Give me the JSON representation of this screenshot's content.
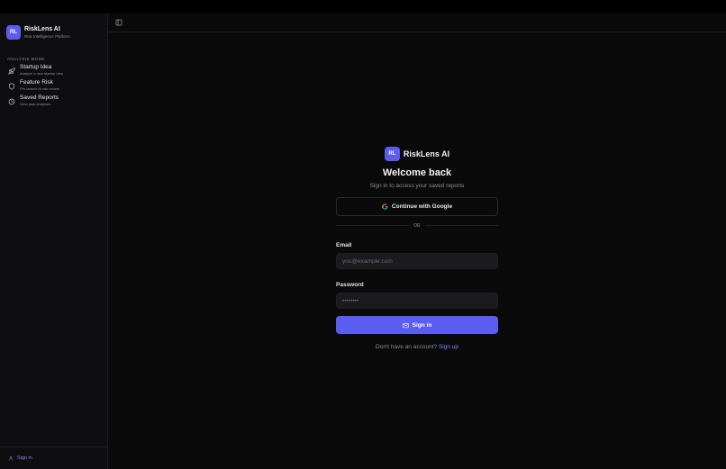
{
  "brand": {
    "initials": "RL",
    "name": "RiskLens AI",
    "subtitle": "Risk Intelligence Platform"
  },
  "sidebar": {
    "section_label": "ANALYSIS MODE",
    "items": [
      {
        "title": "Startup Idea",
        "description": "Analyze a new startup idea",
        "icon": "rocket-icon"
      },
      {
        "title": "Feature Risk",
        "description": "Pre-launch AI risk review",
        "icon": "shield-icon"
      },
      {
        "title": "Saved Reports",
        "description": "View past analyses",
        "icon": "clock-icon"
      }
    ],
    "footer_signin": "Sign in"
  },
  "auth": {
    "brand_initials": "RL",
    "brand_name": "RiskLens AI",
    "title": "Welcome back",
    "subtitle": "Sign in to access your saved reports",
    "google_label": "Continue with Google",
    "divider": "OR",
    "email_label": "Email",
    "email_placeholder": "you@example.com",
    "password_label": "Password",
    "password_placeholder": "••••••••",
    "signin_label": "Sign in",
    "signup_prompt": "Don't have an account?",
    "signup_link": "Sign up"
  },
  "colors": {
    "accent": "#5b5cf0",
    "link": "#7f8cff",
    "background": "#0a0a0b",
    "sidebar": "#0e0e10"
  }
}
